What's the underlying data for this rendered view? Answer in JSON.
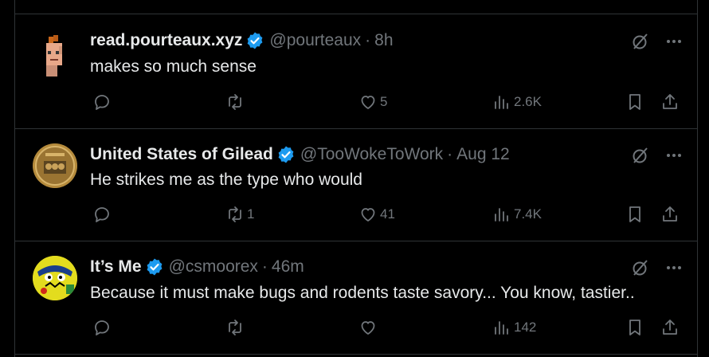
{
  "tweets": [
    {
      "name": "read.pourteaux.xyz",
      "handle": "@pourteaux",
      "time": "8h",
      "text": "makes so much sense",
      "avatar": "pixel-punk-avatar",
      "replies": "",
      "retweets": "",
      "likes": "5",
      "views": "2.6K"
    },
    {
      "name": "United States of Gilead",
      "handle": "@TooWokeToWork",
      "time": "Aug 12",
      "text": "He strikes me as the type who would",
      "avatar": "coin-seal-avatar",
      "replies": "",
      "retweets": "1",
      "likes": "41",
      "views": "7.4K"
    },
    {
      "name": "It’s Me",
      "handle": "@csmoorex",
      "time": "46m",
      "text": "Because it must make bugs and rodents taste savory... You know, tastier..",
      "avatar": "cartoon-face-avatar",
      "replies": "",
      "retweets": "",
      "likes": "",
      "views": "142"
    }
  ],
  "colors": {
    "background": "#000000",
    "text": "#e7e9ea",
    "muted": "#71767b",
    "verified": "#1d9bf0",
    "divider": "#2f3336"
  },
  "icons": [
    "verified-badge-icon",
    "grok-icon",
    "more-icon",
    "reply-icon",
    "retweet-icon",
    "like-icon",
    "views-icon",
    "bookmark-icon",
    "share-icon"
  ]
}
